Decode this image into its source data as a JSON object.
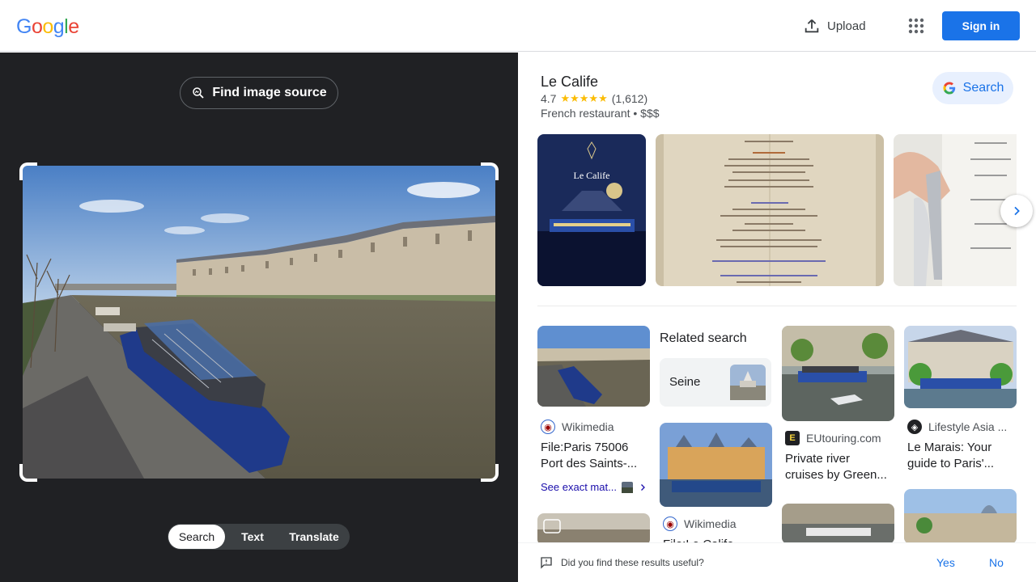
{
  "header": {
    "logo_letters": [
      "G",
      "o",
      "o",
      "g",
      "l",
      "e"
    ],
    "logo_colors": [
      "#4285f4",
      "#ea4335",
      "#fbbc05",
      "#4285f4",
      "#34a853",
      "#ea4335"
    ],
    "upload_label": "Upload",
    "signin_label": "Sign in"
  },
  "left": {
    "find_source_label": "Find image source",
    "modes": [
      "Search",
      "Text",
      "Translate"
    ],
    "active_mode": "Search"
  },
  "place": {
    "name": "Le Calife",
    "rating": "4.7",
    "stars": "★★★★★",
    "reviews": "(1,612)",
    "type": "French restaurant • $$$",
    "search_label": "Search",
    "thumb1_text": "Le Calife"
  },
  "results": {
    "related_heading": "Related search",
    "related_chip": "Seine",
    "cards": [
      {
        "source": "Wikimedia",
        "title": "File:Paris 75006 Port des Saints-...",
        "exact": "See exact mat..."
      },
      {
        "source": "Wikimedia",
        "title": "File:Le Calife..."
      },
      {
        "source": "EUtouring.com",
        "title": "Private river cruises by Green..."
      },
      {
        "source": "Lifestyle Asia ...",
        "title": "Le Marais: Your guide to Paris'..."
      }
    ]
  },
  "feedback": {
    "question": "Did you find these results useful?",
    "yes": "Yes",
    "no": "No"
  },
  "colors": {
    "accent": "#1a73e8",
    "dark_panel": "#202124"
  }
}
